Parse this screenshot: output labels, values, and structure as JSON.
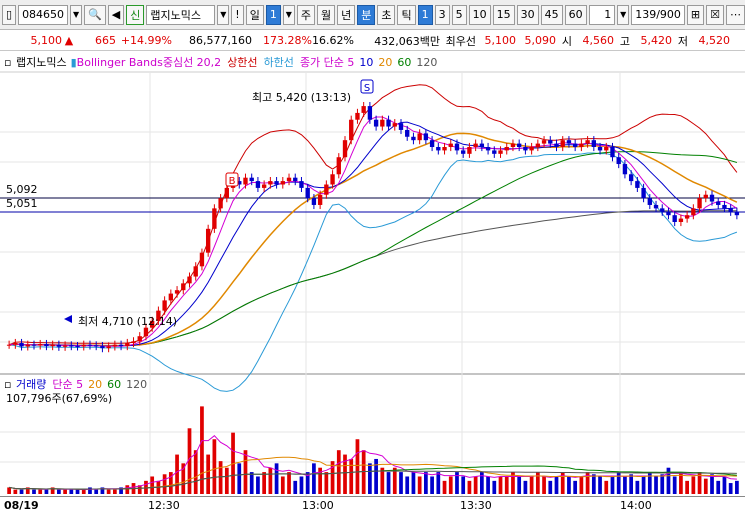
{
  "toolbar": {
    "code": "084650",
    "sin_label": "신",
    "stock_name": "랩지노믹스",
    "alert": "!",
    "period_sel": "일",
    "period_num": "1",
    "week": "주",
    "month": "월",
    "year": "년",
    "minute": "분",
    "second": "초",
    "tick": "틱",
    "intervals": [
      "1",
      "3",
      "5",
      "10",
      "15",
      "30",
      "45",
      "60"
    ],
    "count": "1",
    "position": "139/900"
  },
  "quote": {
    "price": "5,100",
    "change": "665",
    "change_pct": "+14.99%",
    "volume": "86,577,160",
    "vol_ratio": "173.28%",
    "turnover": "16.62%",
    "amount": "432,063백만",
    "best_label": "최우선",
    "best_ask": "5,100",
    "best_bid": "5,090",
    "open_label": "시",
    "open": "4,560",
    "high_label": "고",
    "high": "5,420",
    "low_label": "저",
    "low": "4,520"
  },
  "legend": {
    "name": "랩지노믹스",
    "bb_mid": "Bollinger Bands중심선 20,2",
    "bb_up": "상한선",
    "bb_low": "하한선",
    "ma_label": "종가 단순 5",
    "ma10": "10",
    "ma20": "20",
    "ma60": "60",
    "ma120": "120"
  },
  "annotations": {
    "high": "최고 5,420 (13:13)",
    "low": "최저 4,710 (12:14)",
    "level1": "5,092",
    "level2": "5,051",
    "marker_b": "B",
    "marker_s": "S"
  },
  "volume": {
    "label": "거래량",
    "ma_label": "단순 5",
    "ma20": "20",
    "ma60": "60",
    "ma120": "120",
    "value": "107,796주(67,69%)"
  },
  "xaxis": {
    "date": "08/19",
    "t1": "12:30",
    "t2": "13:00",
    "t3": "13:30",
    "t4": "14:00"
  },
  "colors": {
    "up": "#e00000",
    "down": "#0000cc",
    "bb_mid": "#008b8b",
    "bb_up": "#cc0000",
    "bb_low": "#2a9ad6",
    "ma5": "#d400d4",
    "ma10": "#0000cc",
    "ma20": "#e08800",
    "ma60": "#008000",
    "ma120": "#555555"
  },
  "chart_data": {
    "type": "candlestick",
    "price_series": [
      4720,
      4725,
      4715,
      4720,
      4718,
      4722,
      4716,
      4720,
      4714,
      4718,
      4716,
      4715,
      4720,
      4718,
      4716,
      4710,
      4715,
      4720,
      4716,
      4725,
      4730,
      4745,
      4770,
      4790,
      4820,
      4850,
      4870,
      4880,
      4900,
      4920,
      4950,
      4990,
      5060,
      5120,
      5150,
      5180,
      5200,
      5190,
      5210,
      5200,
      5180,
      5190,
      5200,
      5190,
      5200,
      5210,
      5200,
      5180,
      5150,
      5130,
      5160,
      5190,
      5220,
      5270,
      5320,
      5380,
      5400,
      5420,
      5380,
      5360,
      5380,
      5360,
      5370,
      5350,
      5330,
      5320,
      5340,
      5320,
      5300,
      5290,
      5300,
      5310,
      5290,
      5280,
      5300,
      5310,
      5300,
      5290,
      5280,
      5290,
      5300,
      5310,
      5300,
      5290,
      5300,
      5310,
      5320,
      5310,
      5300,
      5320,
      5310,
      5300,
      5310,
      5320,
      5300,
      5290,
      5300,
      5270,
      5250,
      5220,
      5200,
      5180,
      5150,
      5130,
      5120,
      5110,
      5100,
      5080,
      5090,
      5100,
      5120,
      5150,
      5160,
      5140,
      5130,
      5120,
      5110,
      5100
    ],
    "volume_series": [
      3,
      2,
      2,
      3,
      2,
      2,
      2,
      3,
      2,
      2,
      2,
      2,
      2,
      3,
      2,
      3,
      2,
      2,
      3,
      4,
      5,
      4,
      6,
      8,
      6,
      9,
      10,
      18,
      14,
      30,
      20,
      40,
      18,
      25,
      15,
      12,
      28,
      14,
      20,
      10,
      8,
      10,
      12,
      14,
      8,
      10,
      6,
      8,
      10,
      14,
      12,
      10,
      15,
      20,
      18,
      16,
      25,
      20,
      14,
      16,
      12,
      10,
      12,
      10,
      8,
      10,
      8,
      10,
      8,
      10,
      6,
      8,
      10,
      8,
      6,
      8,
      10,
      8,
      6,
      8,
      8,
      10,
      8,
      6,
      8,
      10,
      8,
      6,
      8,
      10,
      8,
      6,
      8,
      10,
      9,
      8,
      6,
      8,
      10,
      8,
      9,
      6,
      8,
      10,
      8,
      9,
      12,
      8,
      10,
      6,
      8,
      10,
      7,
      9,
      6,
      8,
      5,
      6
    ],
    "y_levels": [
      "5,092",
      "5,051"
    ]
  }
}
